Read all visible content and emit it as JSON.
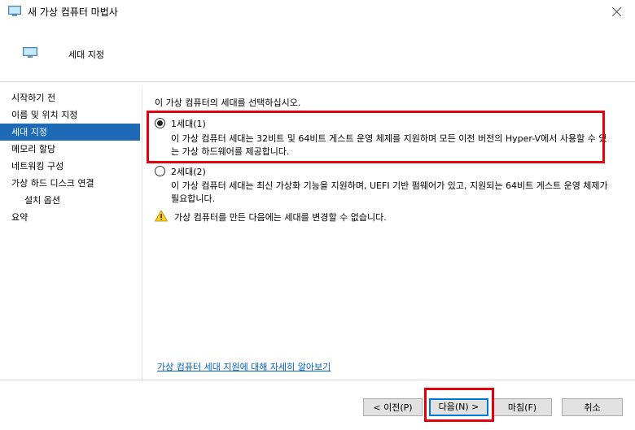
{
  "window": {
    "title": "새 가상 컴퓨터 마법사"
  },
  "header": {
    "title": "세대 지정"
  },
  "sidebar": {
    "items": [
      {
        "label": "시작하기 전"
      },
      {
        "label": "이름 및 위치 지정"
      },
      {
        "label": "세대 지정"
      },
      {
        "label": "메모리 할당"
      },
      {
        "label": "네트워킹 구성"
      },
      {
        "label": "가상 하드 디스크 연결"
      },
      {
        "label": "설치 옵션"
      },
      {
        "label": "요약"
      }
    ],
    "active_index": 2
  },
  "main": {
    "intro": "이 가상 컴퓨터의 세대를 선택하십시오.",
    "options": [
      {
        "label": "1세대(1)",
        "selected": true,
        "description": "이 가상 컴퓨터 세대는 32비트 및 64비트 게스트 운영 체제를 지원하며 모든 이전 버전의 Hyper-V에서 사용할 수 있는 가상 하드웨어를 제공합니다."
      },
      {
        "label": "2세대(2)",
        "selected": false,
        "description": "이 가상 컴퓨터 세대는 최신 가상화 기능을 지원하며, UEFI 기반 펌웨어가 있고, 지원되는 64비트 게스트 운영 체제가 필요합니다."
      }
    ],
    "warning": "가상 컴퓨터를 만든 다음에는 세대를 변경할 수 없습니다.",
    "learn_more": "가상 컴퓨터 세대 지원에 대해 자세히 알아보기"
  },
  "footer": {
    "prev": "< 이전(P)",
    "next": "다음(N) >",
    "finish": "마침(F)",
    "cancel": "취소"
  },
  "colors": {
    "accent": "#1f6ab7",
    "highlight_border": "#e3000f",
    "link": "#0060c0"
  }
}
